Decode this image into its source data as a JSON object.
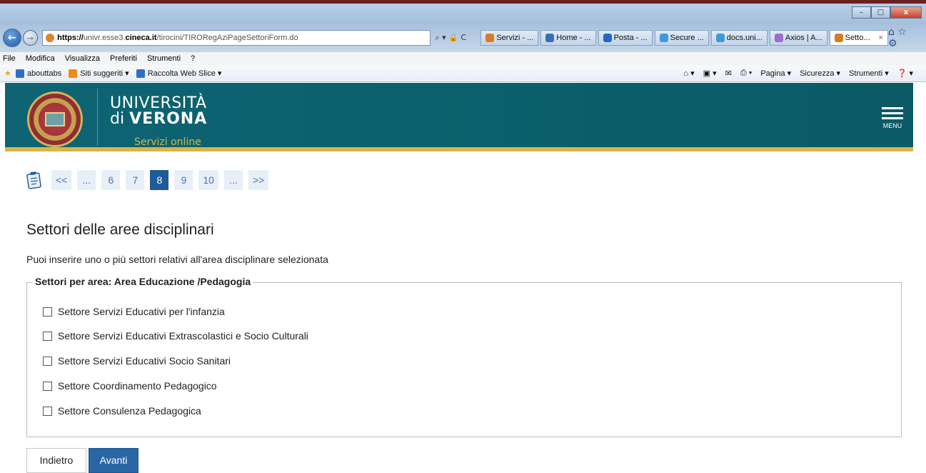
{
  "browser": {
    "url_scheme": "https://",
    "url_host_pre": "univr.esse3.",
    "url_host": "cineca.it",
    "url_path": "/tirocini/TIRORegAziPageSettoriForm.do",
    "addr_tools": "⌕ ▾ 🔒 C",
    "tabs": [
      {
        "label": "Servizi - ...",
        "color": "#d97b26"
      },
      {
        "label": "Home - ...",
        "color": "#3b6fb5"
      },
      {
        "label": "Posta - ...",
        "color": "#2368c6"
      },
      {
        "label": "Secure ...",
        "color": "#3c9ad8"
      },
      {
        "label": "docs.uni...",
        "color": "#3c9ad8"
      },
      {
        "label": "Axios | A...",
        "color": "#9c6cc9"
      },
      {
        "label": "Setto...",
        "color": "#d97b26"
      }
    ],
    "active_tab_close": "×",
    "right_icons": "⌂ ☆ ⚙",
    "window_min": "–",
    "window_max": "□",
    "window_close": "x"
  },
  "menubar": [
    "File",
    "Modifica",
    "Visualizza",
    "Preferiti",
    "Strumenti",
    "?"
  ],
  "favorites": {
    "items": [
      {
        "label": "abouttabs",
        "color": "#2f6fc2"
      },
      {
        "label": "Siti suggeriti ▾",
        "color": "#f08a1c"
      },
      {
        "label": "Raccolta Web Slice ▾",
        "color": "#2f6fc2"
      }
    ],
    "right_tools": [
      "⌂ ▾",
      "▣ ▾",
      "✉",
      "⎙ ▾",
      "Pagina ▾",
      "Sicurezza ▾",
      "Strumenti ▾",
      "❓ ▾"
    ]
  },
  "header": {
    "line1": "UNIVERSITÀ",
    "line2_pre": "di ",
    "line2_bold": "VERONA",
    "tagline": "Servizi online",
    "menu_label": "MENU"
  },
  "pager": {
    "items": [
      "<<",
      "...",
      "6",
      "7",
      "8",
      "9",
      "10",
      "...",
      ">>"
    ],
    "active": "8"
  },
  "content": {
    "title": "Settori delle aree disciplinari",
    "intro": "Puoi inserire uno o più settori relativi all'area disciplinare selezionata",
    "legend": "Settori per area: Area Educazione /Pedagogia",
    "options": [
      "Settore Servizi Educativi per l'infanzia",
      "Settore Servizi Educativi Extrascolastici e Socio Culturali",
      "Settore Servizi Educativi Socio Sanitari",
      "Settore Coordinamento Pedagogico",
      "Settore Consulenza Pedagogica"
    ]
  },
  "buttons": {
    "back": "Indietro",
    "next": "Avanti"
  }
}
